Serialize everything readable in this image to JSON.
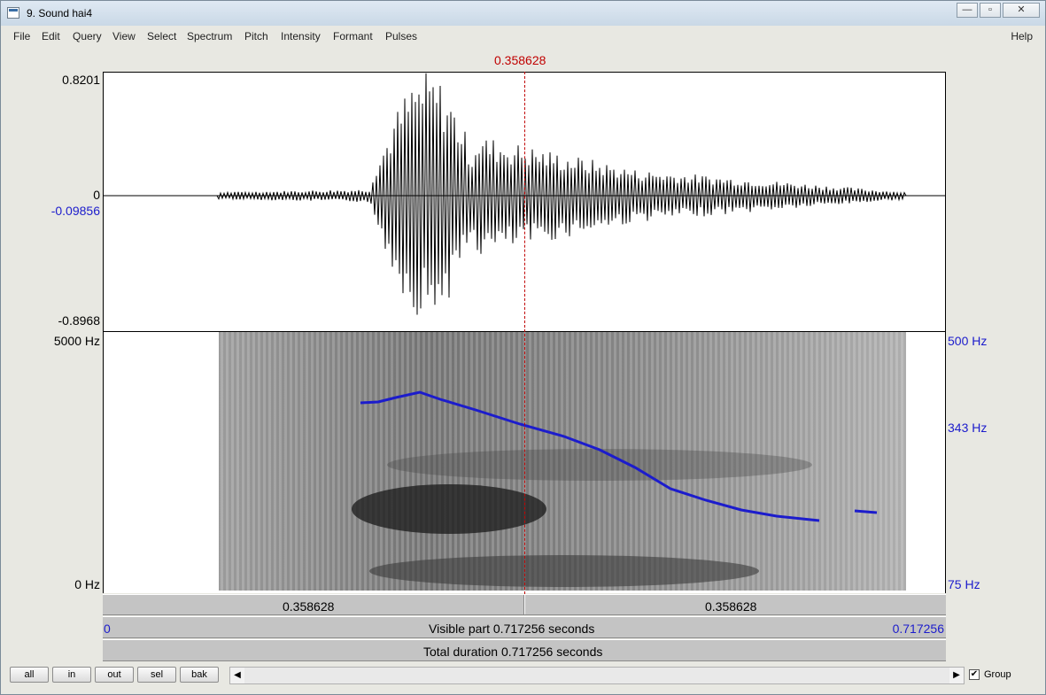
{
  "window": {
    "title": "9. Sound hai4",
    "buttons": [
      "—",
      "▫",
      "✕"
    ]
  },
  "menu": {
    "items": [
      "File",
      "Edit",
      "Query",
      "View",
      "Select",
      "Spectrum",
      "Pitch",
      "Intensity",
      "Formant",
      "Pulses"
    ],
    "help": "Help"
  },
  "cursor": {
    "time_label": "0.358628"
  },
  "waveform": {
    "y_top": "0.8201",
    "y_zero": "0",
    "y_cursor_value": "-0.09856",
    "y_bottom": "-0.8968"
  },
  "spectrogram": {
    "freq_top": "5000 Hz",
    "freq_bottom": "0 Hz",
    "pitch_top": "500 Hz",
    "pitch_mid": "343 Hz",
    "pitch_bottom": "75 Hz"
  },
  "selection_bar": {
    "left_label": "0.358628",
    "right_label": "0.358628"
  },
  "visible_bar": {
    "start": "0",
    "text": "Visible part 0.717256 seconds",
    "end": "0.717256"
  },
  "total_bar": {
    "text": "Total duration 0.717256 seconds"
  },
  "buttons": {
    "all": "all",
    "in": "in",
    "out": "out",
    "sel": "sel",
    "bak": "bak"
  },
  "scrollbar": {
    "left_arrow": "◀",
    "right_arrow": "▶"
  },
  "group": {
    "checked": "✔",
    "label": "Group"
  },
  "colors": {
    "cursor": "#c00000",
    "pitch": "#1c1ccc"
  }
}
